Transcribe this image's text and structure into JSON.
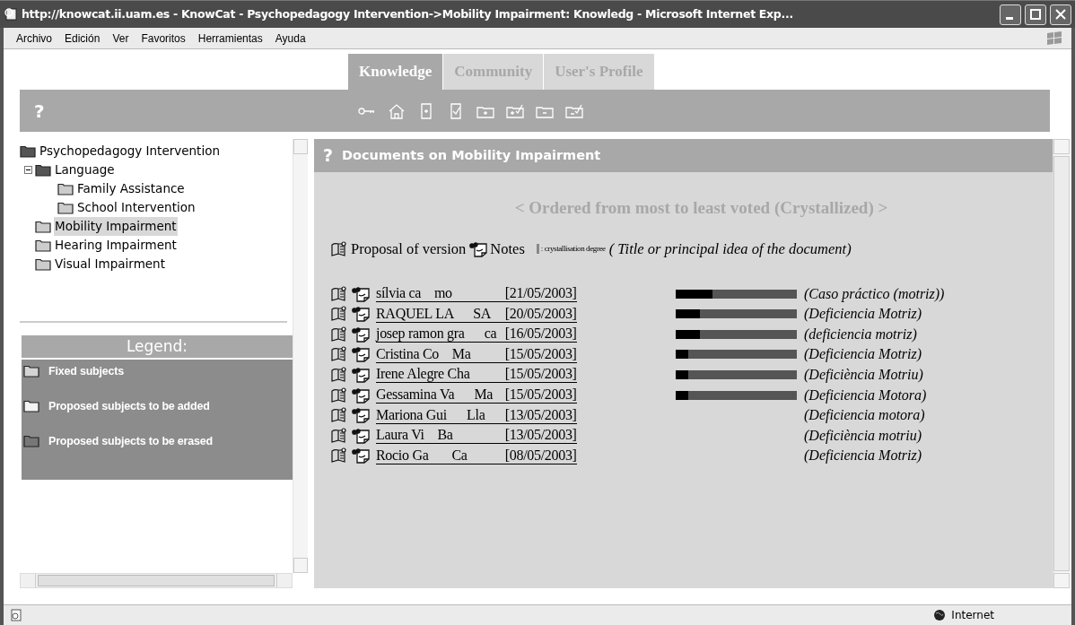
{
  "window": {
    "title": "http://knowcat.ii.uam.es - KnowCat - Psychopedagogy Intervention->Mobility Impairment: Knowledg - Microsoft Internet Exp..."
  },
  "menu": [
    "Archivo",
    "Edición",
    "Ver",
    "Favoritos",
    "Herramientas",
    "Ayuda"
  ],
  "tabs": [
    {
      "label": "Knowledge",
      "selected": true
    },
    {
      "label": "Community",
      "selected": false
    },
    {
      "label": "User's Profile",
      "selected": false
    }
  ],
  "toolbar": {
    "help": "?"
  },
  "tree": {
    "label": "Psychopedagogy Intervention",
    "selected": false,
    "children": [
      {
        "label": "Language",
        "selected": false,
        "children": [
          {
            "label": "Family Assistance",
            "selected": false
          },
          {
            "label": "School Intervention",
            "selected": false
          }
        ]
      },
      {
        "label": "Mobility Impairment",
        "selected": true
      },
      {
        "label": "Hearing Impairment",
        "selected": false
      },
      {
        "label": "Visual Impairment",
        "selected": false
      }
    ]
  },
  "legend": {
    "title": "Legend:",
    "items": [
      {
        "kind": "fixed",
        "label": "Fixed subjects"
      },
      {
        "kind": "added",
        "label": "Proposed subjects to be added"
      },
      {
        "kind": "erased",
        "label": "Proposed subjects to be erased"
      }
    ]
  },
  "documents": {
    "help": "?",
    "title": "Documents on Mobility Impairment",
    "order_note": "< Ordered from most to least voted (Crystallized) >",
    "key": {
      "proposal": "Proposal of version",
      "notes": "Notes",
      "degree": ": crystallisation degree",
      "title_hint": "( Title or principal idea of the document)"
    },
    "rows": [
      {
        "author": "sílvia ca    mo",
        "date": "[21/05/2003]",
        "level": 0.3,
        "title": "(Caso práctico (motriz))"
      },
      {
        "author": "RAQUEL LA      SA",
        "date": "[20/05/2003]",
        "level": 0.2,
        "title": "(Deficiencia Motriz)"
      },
      {
        "author": "josep ramon gra      ca",
        "date": "[16/05/2003]",
        "level": 0.2,
        "title": "(deficiencia motriz)"
      },
      {
        "author": "Cristina Co    Ma",
        "date": "[15/05/2003]",
        "level": 0.1,
        "title": "(Deficiencia Motriz)"
      },
      {
        "author": "Irene Alegre Cha",
        "date": "[15/05/2003]",
        "level": 0.1,
        "title": "(Deficiència Motriu)"
      },
      {
        "author": "Gessamina Va      Ma",
        "date": "[15/05/2003]",
        "level": 0.1,
        "title": "(Deficiencia Motora)"
      },
      {
        "author": "Mariona Gui      Lla",
        "date": "[13/05/2003]",
        "title": "(Deficiencia motora)"
      },
      {
        "author": "Laura Vi    Ba",
        "date": "[13/05/2003]",
        "title": "(Deficiència motriu)"
      },
      {
        "author": "Rocio Ga       Ca",
        "date": "[08/05/2003]",
        "title": "(Deficiencia Motriz)"
      }
    ]
  },
  "status_bar": {
    "zone": "Internet"
  }
}
